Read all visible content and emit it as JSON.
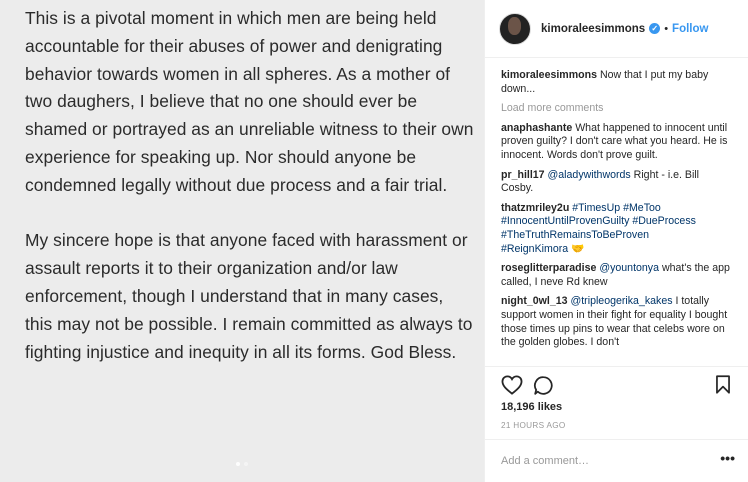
{
  "post": {
    "paragraphs": [
      "This is a pivotal moment in which men are being held accountable for their abuses of power and denigrating behavior towards women in all spheres. As a mother of two daughers, I believe that no one should ever be shamed or portrayed as an unreliable witness to their own experience for speaking up. Nor should anyone be condemned legally without due process and a fair trial.",
      "My sincere hope is that anyone faced with harassment or assault reports it to their organization and/or law enforcement, though I understand that in many cases, this may not be possible. I remain committed as always to fighting injustice and inequity in all its forms. God Bless."
    ]
  },
  "header": {
    "username": "kimoraleesimmons",
    "separator": "•",
    "follow_label": "Follow",
    "verified_mark": "✓"
  },
  "caption": {
    "username": "kimoraleesimmons",
    "text": "Now that I put my baby down..."
  },
  "load_more_label": "Load more comments",
  "comments": [
    {
      "user": "anaphashante",
      "text": "What happened to innocent until proven guilty? I don't care what you heard. He is innocent. Words don't prove guilt."
    },
    {
      "user": "pr_hill17",
      "mention": "@aladywithwords",
      "text": "Right - i.e. Bill Cosby."
    },
    {
      "user": "thatzmriley2u",
      "tags": [
        "#TimesUp",
        "#MeToo",
        "#InnocentUntilProvenGuilty",
        "#DueProcess",
        "#TheTruthRemainsToBeProven",
        "#ReignKimora"
      ],
      "emoji": "🤝"
    },
    {
      "user": "roseglitterparadise",
      "mention": "@yountonya",
      "text": "what's the app called, I neve Rd knew"
    },
    {
      "user": "night_0wl_13",
      "mention": "@tripleogerika_kakes",
      "text": "I totally support women in their fight for equality I bought those times up pins to wear that celebs wore on the golden globes. I don't"
    }
  ],
  "likes": "18,196 likes",
  "time": "21 HOURS AGO",
  "add_comment": {
    "placeholder": "Add a comment…"
  },
  "more_label": "•••",
  "icons": [
    "heart-icon",
    "comment-icon",
    "bookmark-icon"
  ],
  "colors": {
    "link": "#3897f0",
    "hashtag": "#003569",
    "muted": "#999999"
  }
}
